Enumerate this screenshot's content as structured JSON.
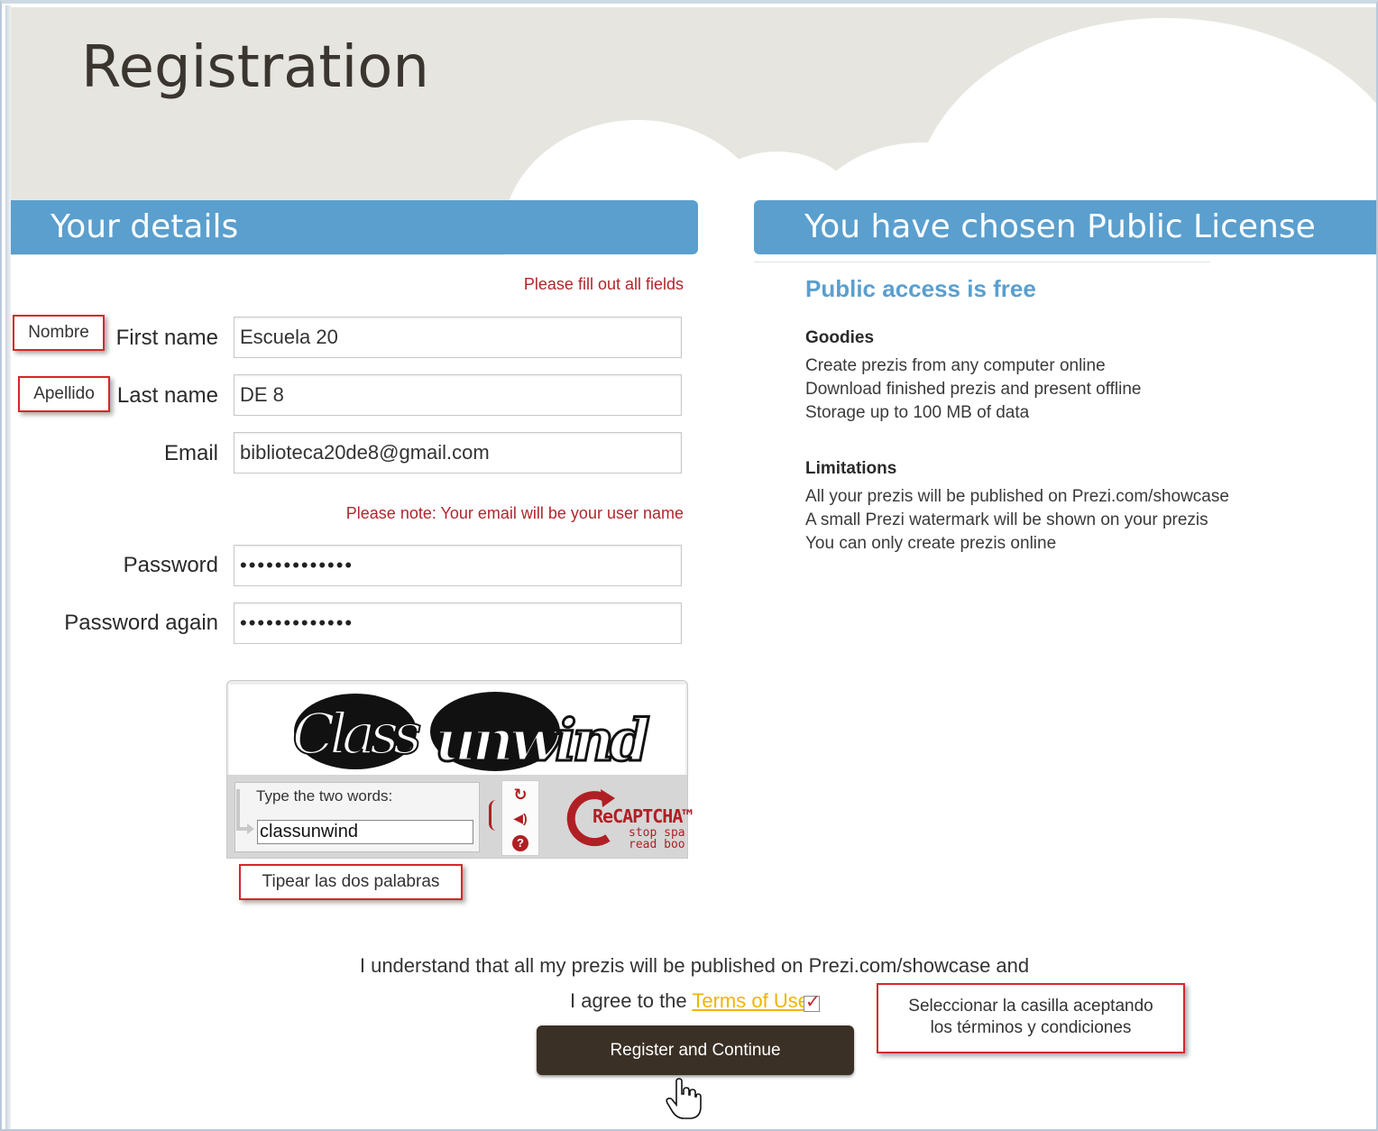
{
  "header": {
    "title": "Registration"
  },
  "left_band": {
    "title": "Your details"
  },
  "right_band": {
    "title": "You have chosen Public License"
  },
  "form": {
    "required_note": "Please fill out all fields",
    "first_name": {
      "label": "First name",
      "value": "Escuela 20"
    },
    "last_name": {
      "label": "Last name",
      "value": "DE 8"
    },
    "email": {
      "label": "Email",
      "value": "biblioteca20de8@gmail.com"
    },
    "email_note": "Please note: Your email will be your user name",
    "password": {
      "label": "Password",
      "value": "•••••••••••••"
    },
    "password_again": {
      "label": "Password again",
      "value": "•••••••••••••"
    }
  },
  "captcha": {
    "words": [
      "Class",
      "unwind"
    ],
    "prompt": "Type the two words:",
    "value": "classunwind",
    "brand": "ReCAPTCHA™",
    "brand_sub1": "stop spa",
    "brand_sub2": "read boo",
    "icons": [
      "refresh-icon",
      "audio-icon",
      "help-icon"
    ]
  },
  "callouts": {
    "nombre": "Nombre",
    "apellido": "Apellido",
    "tipear": "Tipear las dos palabras",
    "seleccionar_line1": "Seleccionar la casilla aceptando",
    "seleccionar_line2": "los términos y condiciones"
  },
  "license": {
    "heading": "Public access is free",
    "goodies_title": "Goodies",
    "goodies": [
      "Create prezis from any computer online",
      "Download finished prezis and present offline",
      "Storage up to 100 MB of data"
    ],
    "limitations_title": "Limitations",
    "limitations": [
      "All your prezis will be published on Prezi.com/showcase",
      "A small Prezi watermark will be shown on your prezis",
      "You can only create prezis online"
    ]
  },
  "agreement": {
    "line1": "I understand that all my prezis will be published on Prezi.com/showcase and",
    "line2_prefix": "I agree to the ",
    "terms_link": "Terms of Use",
    "checked": true
  },
  "submit": {
    "label": "Register and Continue"
  },
  "colors": {
    "band": "#5a9fce",
    "error_text": "#b0262c",
    "button": "#3b3026",
    "callout_border": "#d8252b",
    "link": "#f0b400"
  }
}
